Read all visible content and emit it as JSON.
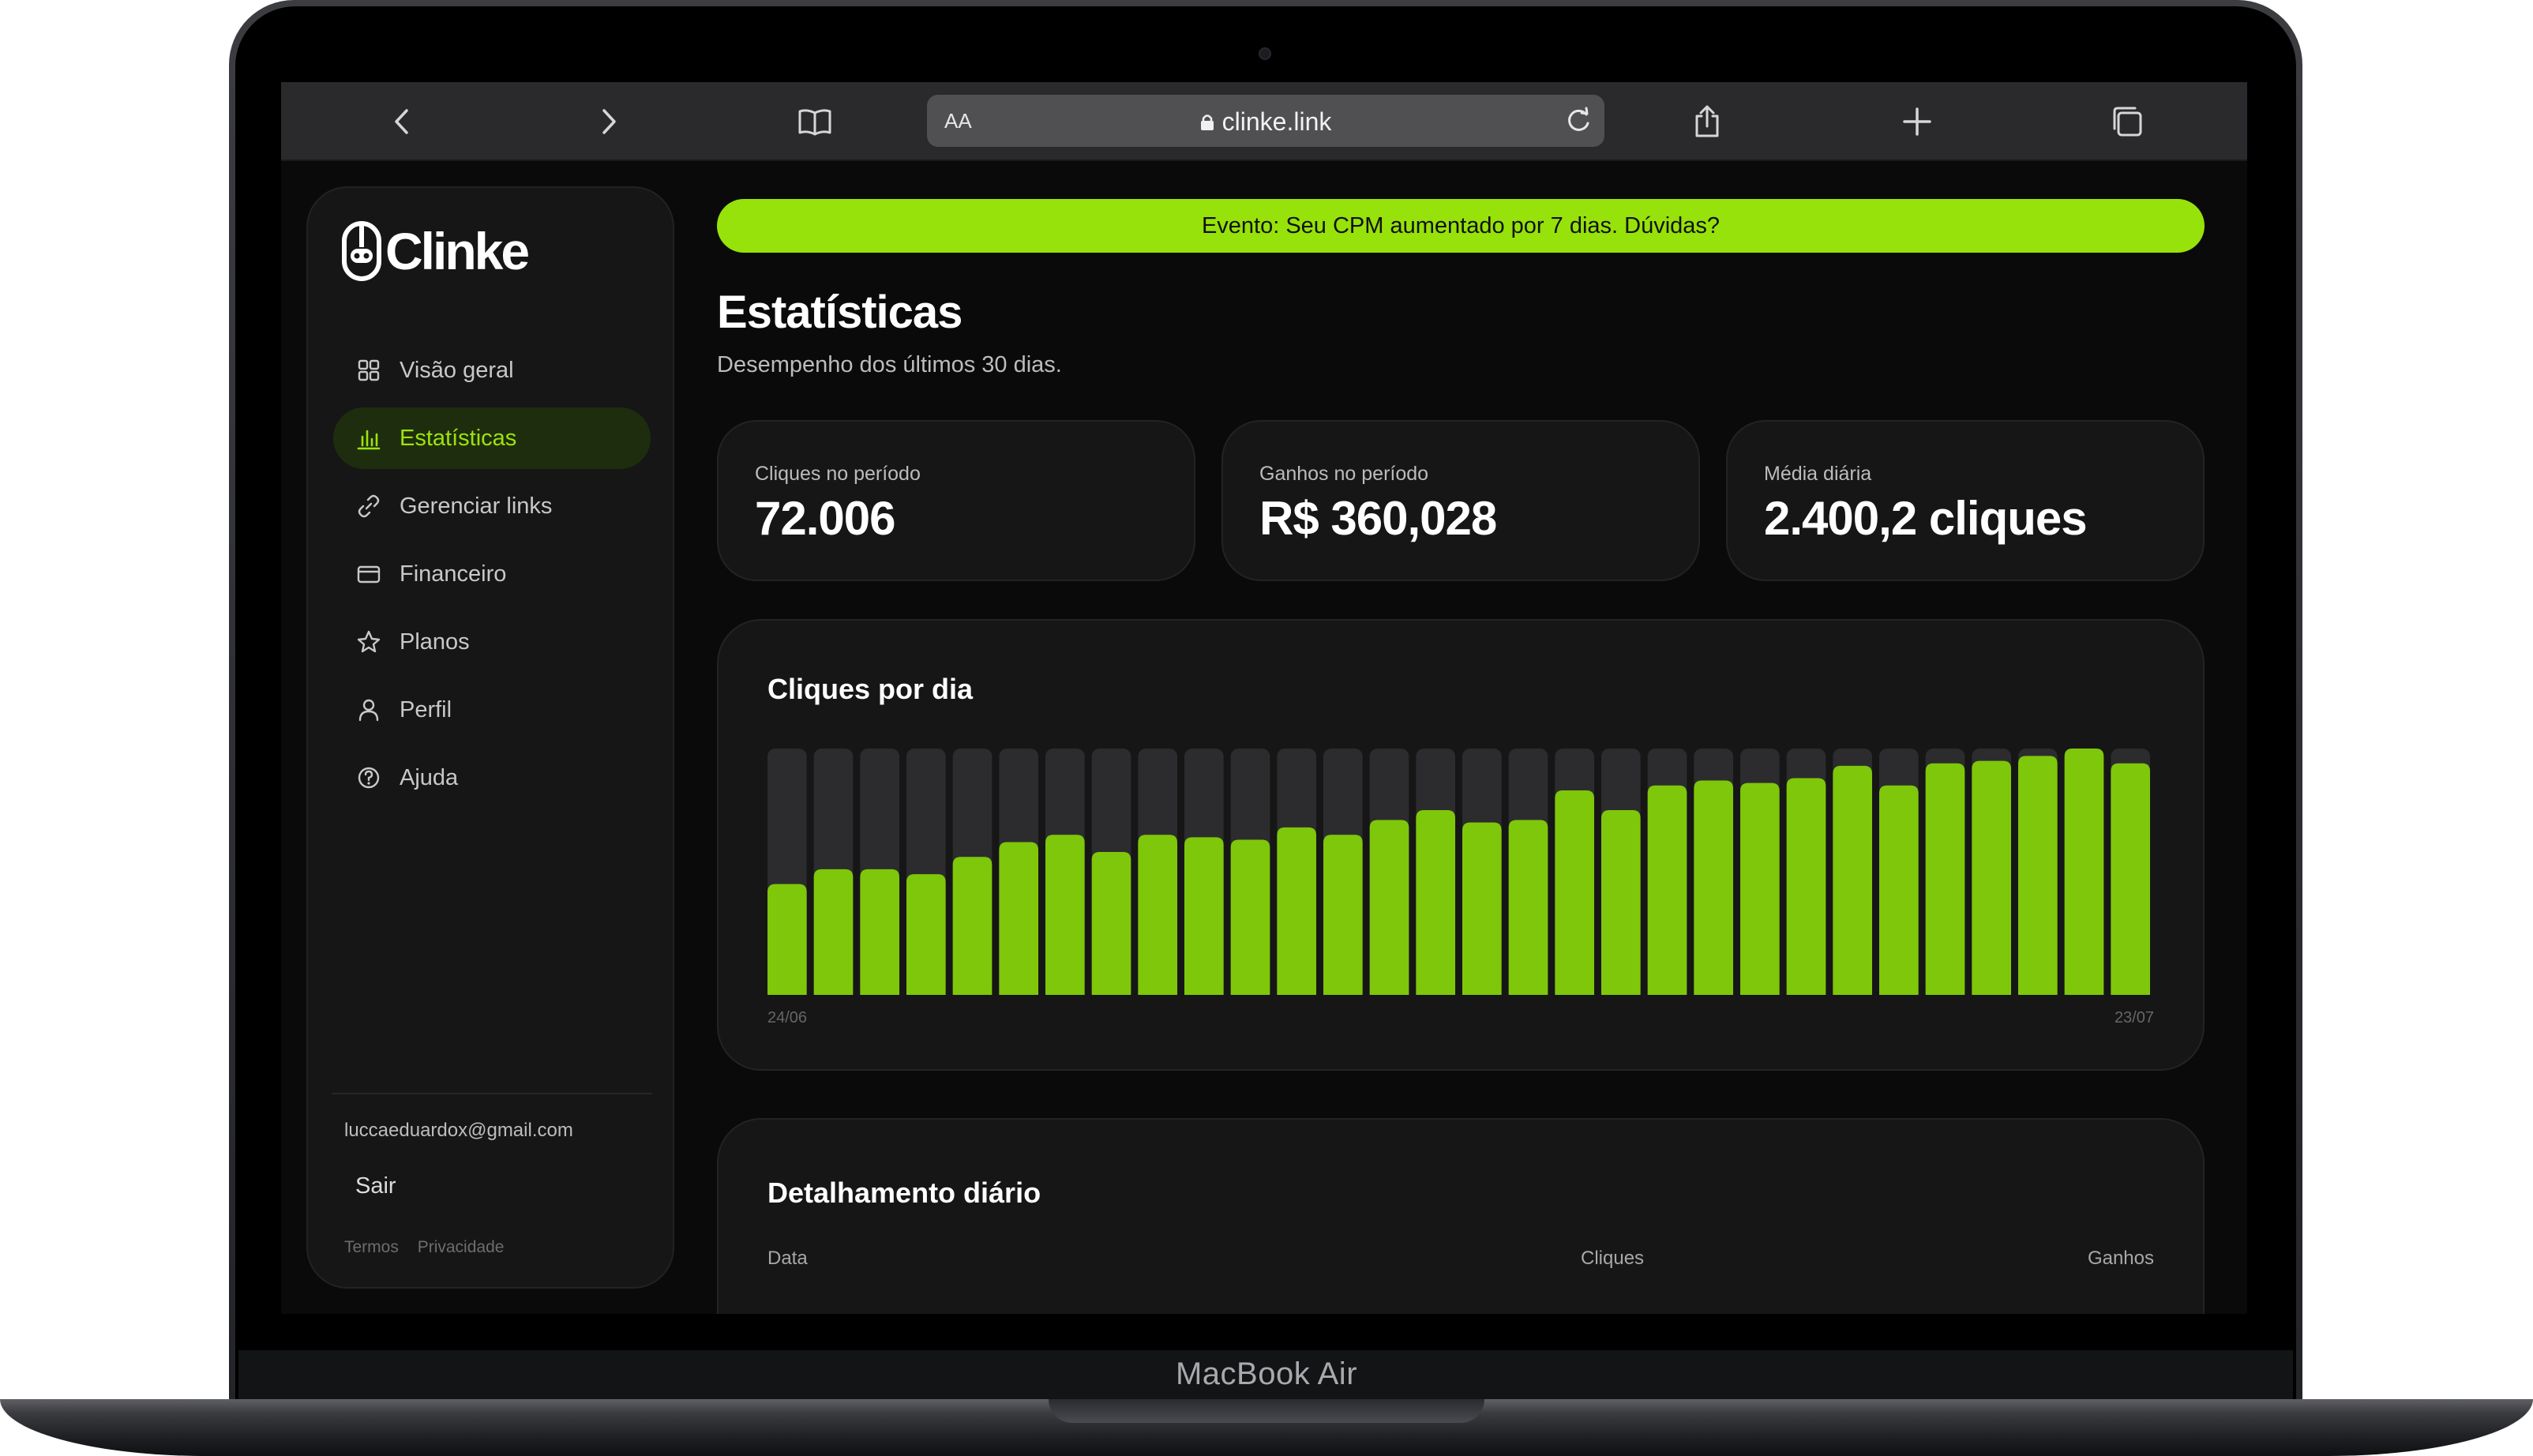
{
  "device": {
    "label": "MacBook Air"
  },
  "browser": {
    "text_size_label": "AA",
    "url": "clinke.link"
  },
  "sidebar": {
    "logo_text": "Clinke",
    "items": [
      {
        "label": "Visão geral",
        "icon": "grid-icon",
        "active": false
      },
      {
        "label": "Estatísticas",
        "icon": "bar-chart-icon",
        "active": true
      },
      {
        "label": "Gerenciar links",
        "icon": "link-icon",
        "active": false
      },
      {
        "label": "Financeiro",
        "icon": "card-icon",
        "active": false
      },
      {
        "label": "Planos",
        "icon": "star-icon",
        "active": false
      },
      {
        "label": "Perfil",
        "icon": "user-icon",
        "active": false
      },
      {
        "label": "Ajuda",
        "icon": "help-icon",
        "active": false
      }
    ],
    "email": "luccaeduardox@gmail.com",
    "logout_label": "Sair",
    "footer": {
      "terms": "Termos",
      "privacy": "Privacidade"
    }
  },
  "banner": {
    "text": "Evento: Seu CPM aumentado por 7 dias. Dúvidas?"
  },
  "page": {
    "title": "Estatísticas",
    "subtitle": "Desempenho dos últimos 30 dias."
  },
  "stats": [
    {
      "label": "Cliques no período",
      "value": "72.006"
    },
    {
      "label": "Ganhos no período",
      "value": "R$ 360,028"
    },
    {
      "label": "Média diária",
      "value": "2.400,2 cliques"
    }
  ],
  "chart_card": {
    "title": "Cliques por dia"
  },
  "chart_data": {
    "type": "bar",
    "title": "Cliques por dia",
    "x_start_label": "24/06",
    "x_end_label": "23/07",
    "values": [
      45,
      51,
      51,
      49,
      56,
      62,
      65,
      58,
      65,
      64,
      63,
      68,
      65,
      71,
      75,
      70,
      71,
      83,
      75,
      85,
      87,
      86,
      88,
      93,
      85,
      94,
      95,
      97,
      100,
      94
    ],
    "ymax": 100,
    "bar_color": "#7fc70a",
    "track_color": "#2c2c2e"
  },
  "table": {
    "title": "Detalhamento diário",
    "columns": [
      "Data",
      "Cliques",
      "Ganhos"
    ]
  },
  "colors": {
    "accent": "#96e20a",
    "background": "#0a0a0a",
    "card": "#161617"
  }
}
